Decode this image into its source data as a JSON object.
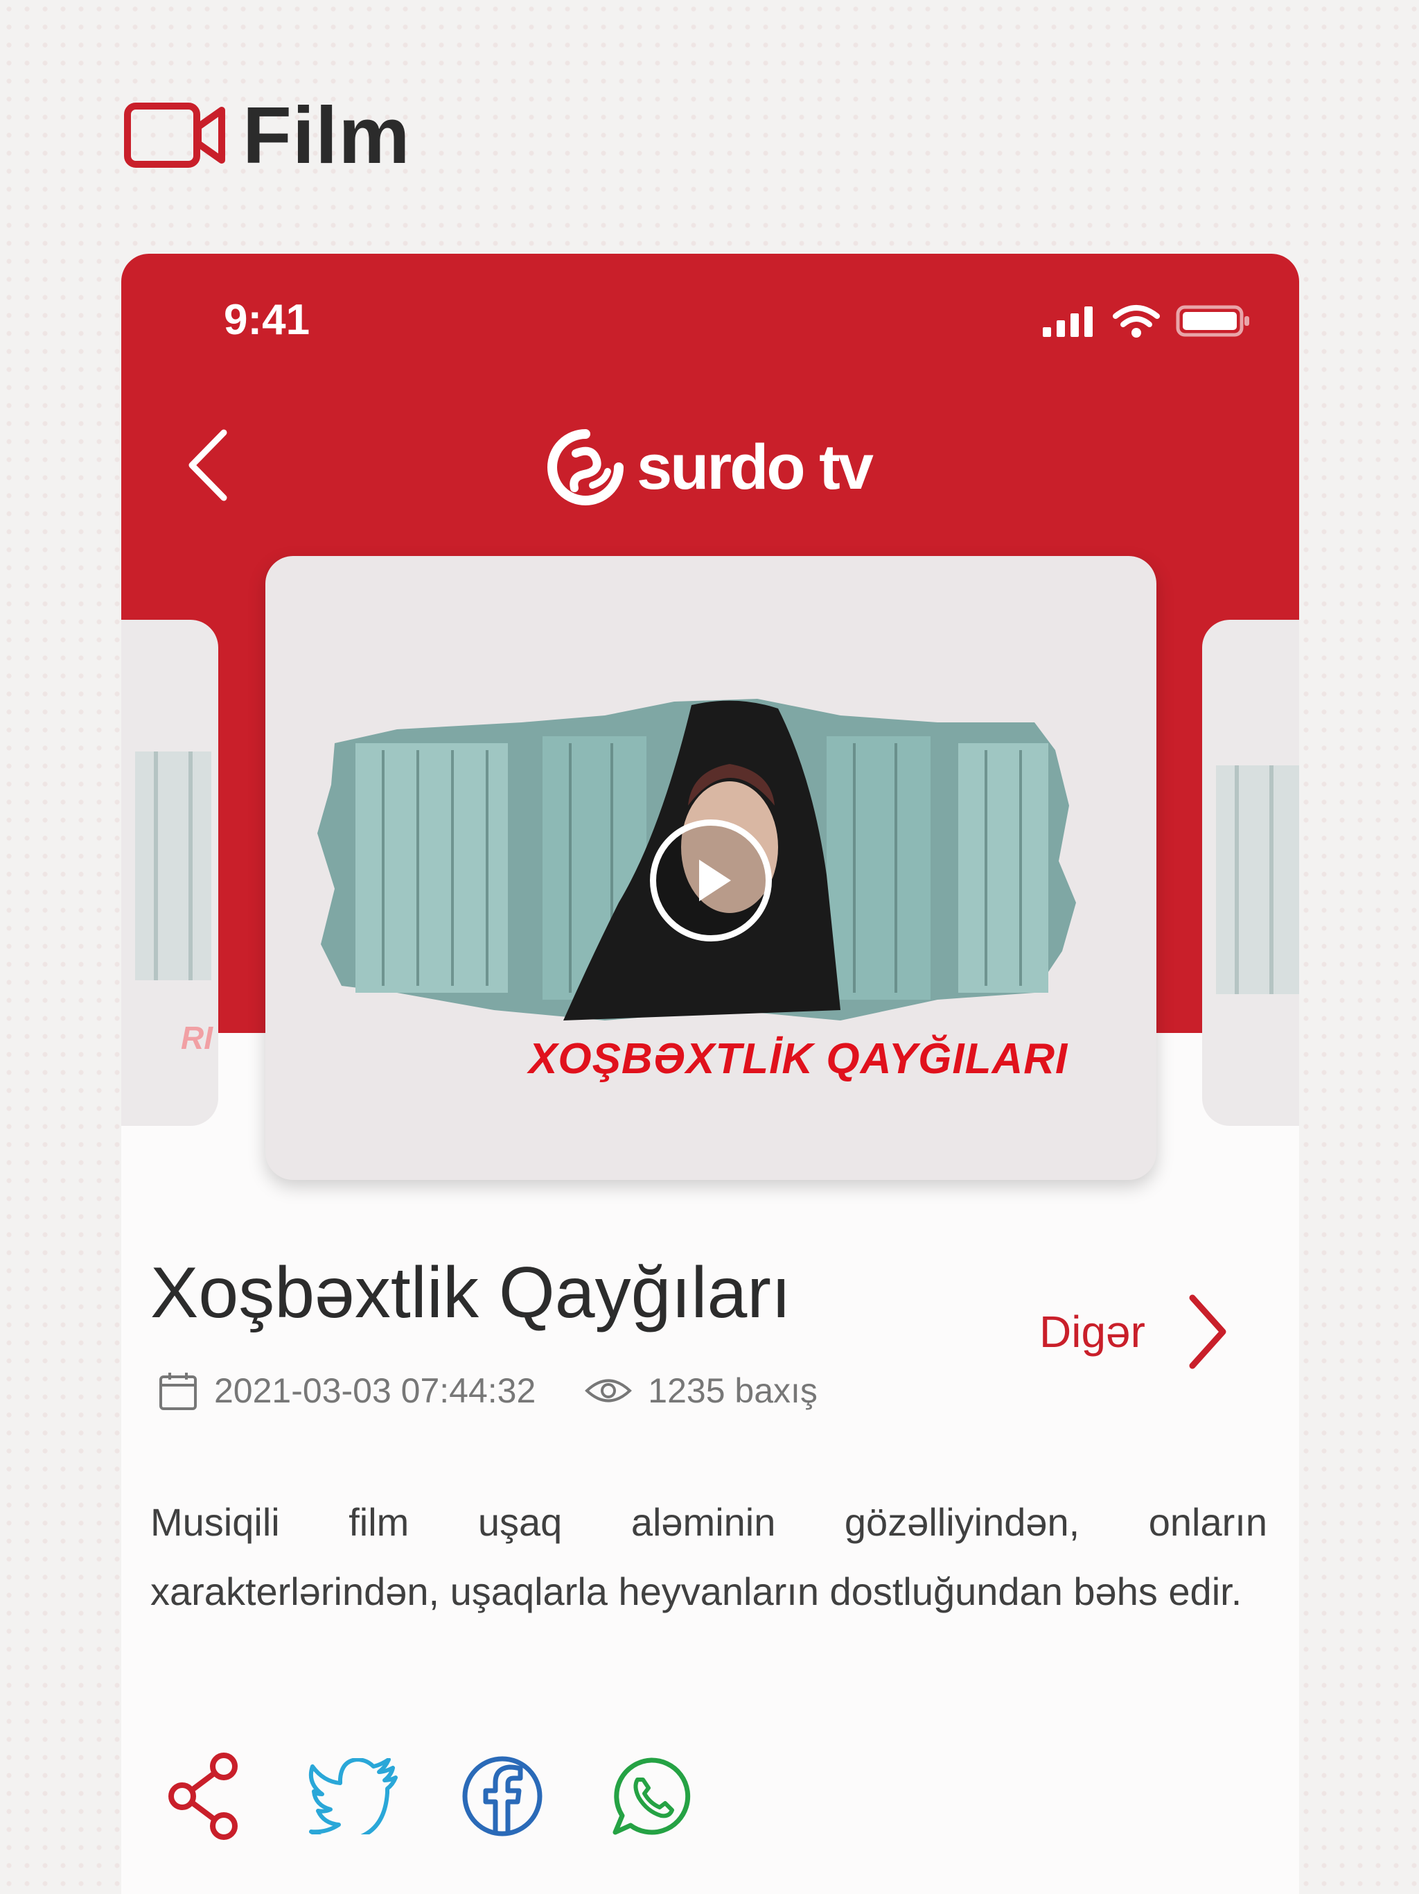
{
  "section": {
    "title": "Film",
    "icon": "video-camera-icon",
    "accent": "#c91f2a"
  },
  "status_bar": {
    "time": "9:41",
    "icons": [
      "signal-icon",
      "wifi-icon",
      "battery-icon"
    ]
  },
  "app_bar": {
    "back_icon": "chevron-left-icon",
    "logo_text": "surdo tv",
    "background": "#c91f2a"
  },
  "carousel": {
    "current": {
      "poster_title": "XOŞBƏXTLİK QAYĞILARI"
    },
    "prev_label": "RI"
  },
  "film": {
    "title": "Xoşbəxtlik Qayğıları",
    "date": "2021-03-03 07:44:32",
    "views": "1235 baxış",
    "description": "Musiqili film uşaq aləminin gözəlliyindən, onların xarakterlərindən, uşaqlarla heyvanların dostluğundan bəhs edir."
  },
  "more": {
    "label": "Digər"
  },
  "share": [
    {
      "name": "share-icon"
    },
    {
      "name": "twitter-icon"
    },
    {
      "name": "facebook-icon"
    },
    {
      "name": "whatsapp-icon"
    }
  ]
}
